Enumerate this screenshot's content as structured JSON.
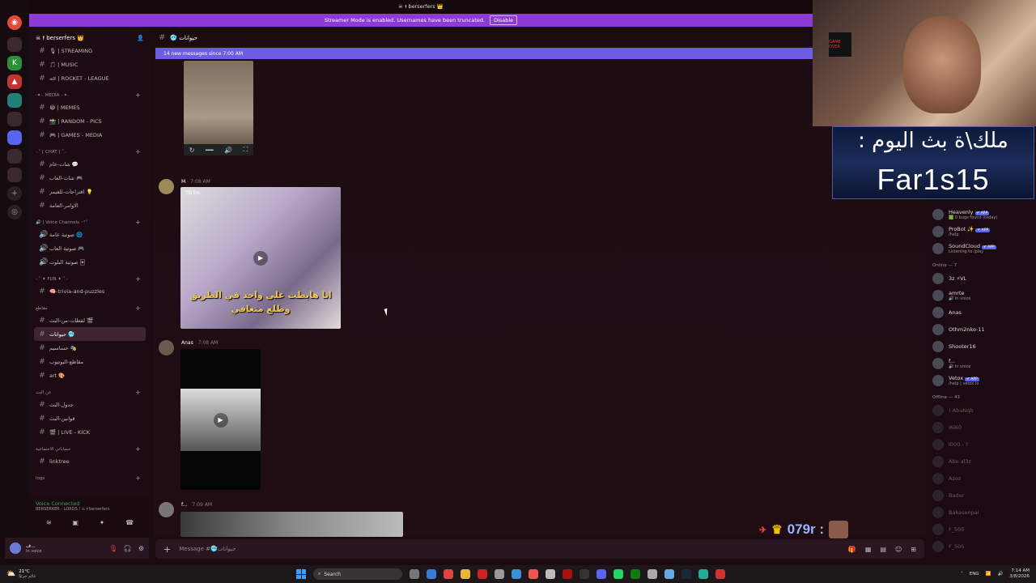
{
  "top_title": "☠ 𝖋 berserfers 👑",
  "banner": {
    "text": "Streamer Mode is enabled. Usernames have been truncated.",
    "button": "Disable"
  },
  "server": {
    "name": "☠ 𝖋 berserfers 👑"
  },
  "channel": {
    "name": "🥶 حيوانات"
  },
  "new_messages": "14 new messages since 7:00 AM",
  "sidebar": {
    "items": [
      {
        "type": "channel",
        "label": "🎙 | STREAMING"
      },
      {
        "type": "channel",
        "label": "🎵 | MUSIC"
      },
      {
        "type": "channel",
        "label": "🏎 | ROCKET - LEAGUE"
      },
      {
        "type": "category",
        "label": "·✦·. MEDIA .·✦·"
      },
      {
        "type": "channel",
        "label": "😂 | MEMES"
      },
      {
        "type": "channel",
        "label": "📸 | RANDOM - PICS"
      },
      {
        "type": "channel",
        "label": "🎮 | GAMES - MEDIA"
      },
      {
        "type": "category",
        "label": "·.˚ [ CHAT ] ˚.·"
      },
      {
        "type": "channel",
        "label": "شات-عام 💬"
      },
      {
        "type": "channel",
        "label": "شات-العاب 🎮"
      },
      {
        "type": "channel",
        "label": "اقتراحات-للقيمز 💡"
      },
      {
        "type": "channel",
        "label": "الاوامر-العامة"
      },
      {
        "type": "category",
        "label": "🔊 | Voice Channels ◦°˚"
      },
      {
        "type": "voice",
        "label": "صوتية عامة 🌐"
      },
      {
        "type": "voice",
        "label": "صوتية العاب 🎮"
      },
      {
        "type": "voice",
        "label": "صوتية البلوت 🃏"
      },
      {
        "type": "category",
        "label": "·.˚ ✦ FUN ✦ ˚.·"
      },
      {
        "type": "channel",
        "label": "🧠-trivia-and-puzzles"
      },
      {
        "type": "category",
        "label": "مقاطع"
      },
      {
        "type": "channel",
        "label": "لقطات-من-البث 🎬"
      },
      {
        "type": "channel",
        "label": "حيوانات 🥶",
        "active": true
      },
      {
        "type": "channel",
        "label": "خساسيم 🎭"
      },
      {
        "type": "channel",
        "label": "مقاطع-اليوتيوب"
      },
      {
        "type": "channel",
        "label": "art 🎨"
      },
      {
        "type": "category",
        "label": "عن البث"
      },
      {
        "type": "channel",
        "label": "جدول-البث"
      },
      {
        "type": "channel",
        "label": "قوانين-البث"
      },
      {
        "type": "channel",
        "label": "🎬 | LIVE - KICK"
      },
      {
        "type": "category",
        "label": "حساباتي الاجتماعية"
      },
      {
        "type": "channel",
        "label": "linktree"
      },
      {
        "type": "category",
        "label": "logs"
      }
    ]
  },
  "voice": {
    "status": "Voice Connected",
    "channel": "BERSERKER - LORDS / ☠ 𝖋 berserfers"
  },
  "user": {
    "name": "ف...",
    "status": "In voice"
  },
  "messages": [
    {
      "author": "",
      "time": ""
    },
    {
      "author": "M",
      "time": "7:08 AM",
      "tiktok": "TikTok",
      "caption": "انا هايطت على واحد في الطريق وطلع متعافي"
    },
    {
      "author": "Anas",
      "time": "7:08 AM"
    },
    {
      "author": "f...",
      "time": "7:09 AM"
    }
  ],
  "composer": {
    "placeholder": "Message #🥶حيوانات"
  },
  "members": {
    "top": [
      {
        "name": "Heavenly",
        "bot": "✔ APP",
        "status": "🟩 0 bugs found (today)"
      },
      {
        "name": "ProBot ✨",
        "bot": "✔ APP",
        "status": "/help"
      },
      {
        "name": "SoundCloud",
        "bot": "✔ APP",
        "status": "Listening to /play"
      }
    ],
    "online_header": "Online — 7",
    "online": [
      {
        "name": "3z ⚡VL",
        "status": ""
      },
      {
        "name": "amrte",
        "status": "🔊 In voice"
      },
      {
        "name": "Anas",
        "status": ""
      },
      {
        "name": "Othm2nko-11",
        "status": ""
      },
      {
        "name": "Shooter16",
        "status": ""
      },
      {
        "name": "f...",
        "status": "🔊 In voice"
      },
      {
        "name": "Vetox",
        "bot": "✔ APP",
        "status": "/help | vetox.io"
      }
    ],
    "offline_header": "Offline — 43",
    "offline": [
      "! AbuNqb",
      "i6l60",
      "l000 - ?",
      "Abo al3z",
      "Azoz",
      "Bader",
      "Bakasenpai",
      "F_505",
      "F_505"
    ]
  },
  "overlay": {
    "line1": "ملك\\ة بث اليوم :",
    "line2": "Far1s15"
  },
  "chat": {
    "text": "079r :"
  },
  "taskbar": {
    "temp": "21°C",
    "weather": "غائم جزئيًا",
    "search": "Search",
    "lang": "ENG",
    "time": "7:14 AM",
    "date": "3/8/2026"
  }
}
